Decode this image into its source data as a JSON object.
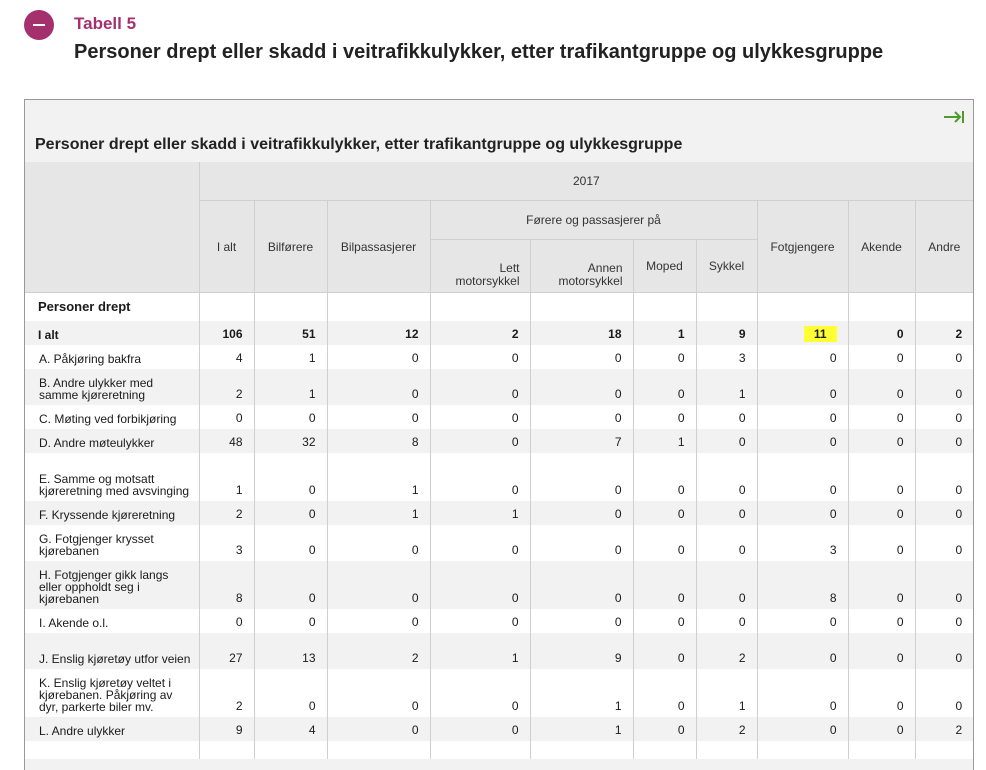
{
  "header": {
    "tabell_label": "Tabell 5",
    "title": "Personer drept eller skadd i veitrafikkulykker, etter trafikantgruppe og ulykkesgruppe"
  },
  "panel": {
    "caption": "Personer drept eller skadd i veitrafikkulykker, etter trafikantgruppe og ulykkesgruppe",
    "expand_icon": "arrow-right-to-bar-icon",
    "accent_color": "#4e9a2a"
  },
  "table": {
    "year": "2017",
    "group_header": "Førere og passasjerer på",
    "columns": {
      "i_alt": "I alt",
      "bilforere": "Bilførere",
      "bilpassasjerer": "Bilpassasjerer",
      "lett_motorsykkel": "Lett motorsykkel",
      "annen_motorsykkel": "Annen motorsykkel",
      "moped": "Moped",
      "sykkel": "Sykkel",
      "fotgjengere": "Fotgjengere",
      "akende": "Akende",
      "andre": "Andre"
    },
    "section_title": "Personer drept",
    "total_row": {
      "label": "I alt",
      "values": [
        "106",
        "51",
        "12",
        "2",
        "18",
        "1",
        "9",
        "11",
        "0",
        "2"
      ]
    },
    "rows": [
      {
        "label": "A. Påkjøring bakfra",
        "values": [
          "4",
          "1",
          "0",
          "0",
          "0",
          "0",
          "3",
          "0",
          "0",
          "0"
        ]
      },
      {
        "label": "B. Andre ulykker med samme kjøreretning",
        "values": [
          "2",
          "1",
          "0",
          "0",
          "0",
          "0",
          "1",
          "0",
          "0",
          "0"
        ]
      },
      {
        "label": "C. Møting ved forbikjøring",
        "values": [
          "0",
          "0",
          "0",
          "0",
          "0",
          "0",
          "0",
          "0",
          "0",
          "0"
        ]
      },
      {
        "label": "D. Andre møteulykker",
        "values": [
          "48",
          "32",
          "8",
          "0",
          "7",
          "1",
          "0",
          "0",
          "0",
          "0"
        ]
      },
      {
        "label": "E. Samme og motsatt kjøreretning med avsvinging",
        "values": [
          "1",
          "0",
          "1",
          "0",
          "0",
          "0",
          "0",
          "0",
          "0",
          "0"
        ]
      },
      {
        "label": "F. Kryssende kjøreretning",
        "values": [
          "2",
          "0",
          "1",
          "1",
          "0",
          "0",
          "0",
          "0",
          "0",
          "0"
        ]
      },
      {
        "label": "G. Fotgjenger krysset kjørebanen",
        "values": [
          "3",
          "0",
          "0",
          "0",
          "0",
          "0",
          "0",
          "3",
          "0",
          "0"
        ]
      },
      {
        "label": "H. Fotgjenger gikk langs eller oppholdt seg i kjørebanen",
        "values": [
          "8",
          "0",
          "0",
          "0",
          "0",
          "0",
          "0",
          "8",
          "0",
          "0"
        ]
      },
      {
        "label": "I. Akende o.l.",
        "values": [
          "0",
          "0",
          "0",
          "0",
          "0",
          "0",
          "0",
          "0",
          "0",
          "0"
        ]
      },
      {
        "label": "J. Enslig kjøretøy utfor veien",
        "values": [
          "27",
          "13",
          "2",
          "1",
          "9",
          "0",
          "2",
          "0",
          "0",
          "0"
        ]
      },
      {
        "label": "K. Enslig kjøretøy veltet i kjørebanen. Påkjøring av dyr, parkerte biler mv.",
        "values": [
          "2",
          "0",
          "0",
          "0",
          "1",
          "0",
          "1",
          "0",
          "0",
          "0"
        ]
      },
      {
        "label": "L. Andre ulykker",
        "values": [
          "9",
          "4",
          "0",
          "0",
          "1",
          "0",
          "2",
          "0",
          "0",
          "2"
        ]
      }
    ],
    "highlight_color": "#ffff33"
  },
  "colors": {
    "brand": "#a4306e"
  }
}
